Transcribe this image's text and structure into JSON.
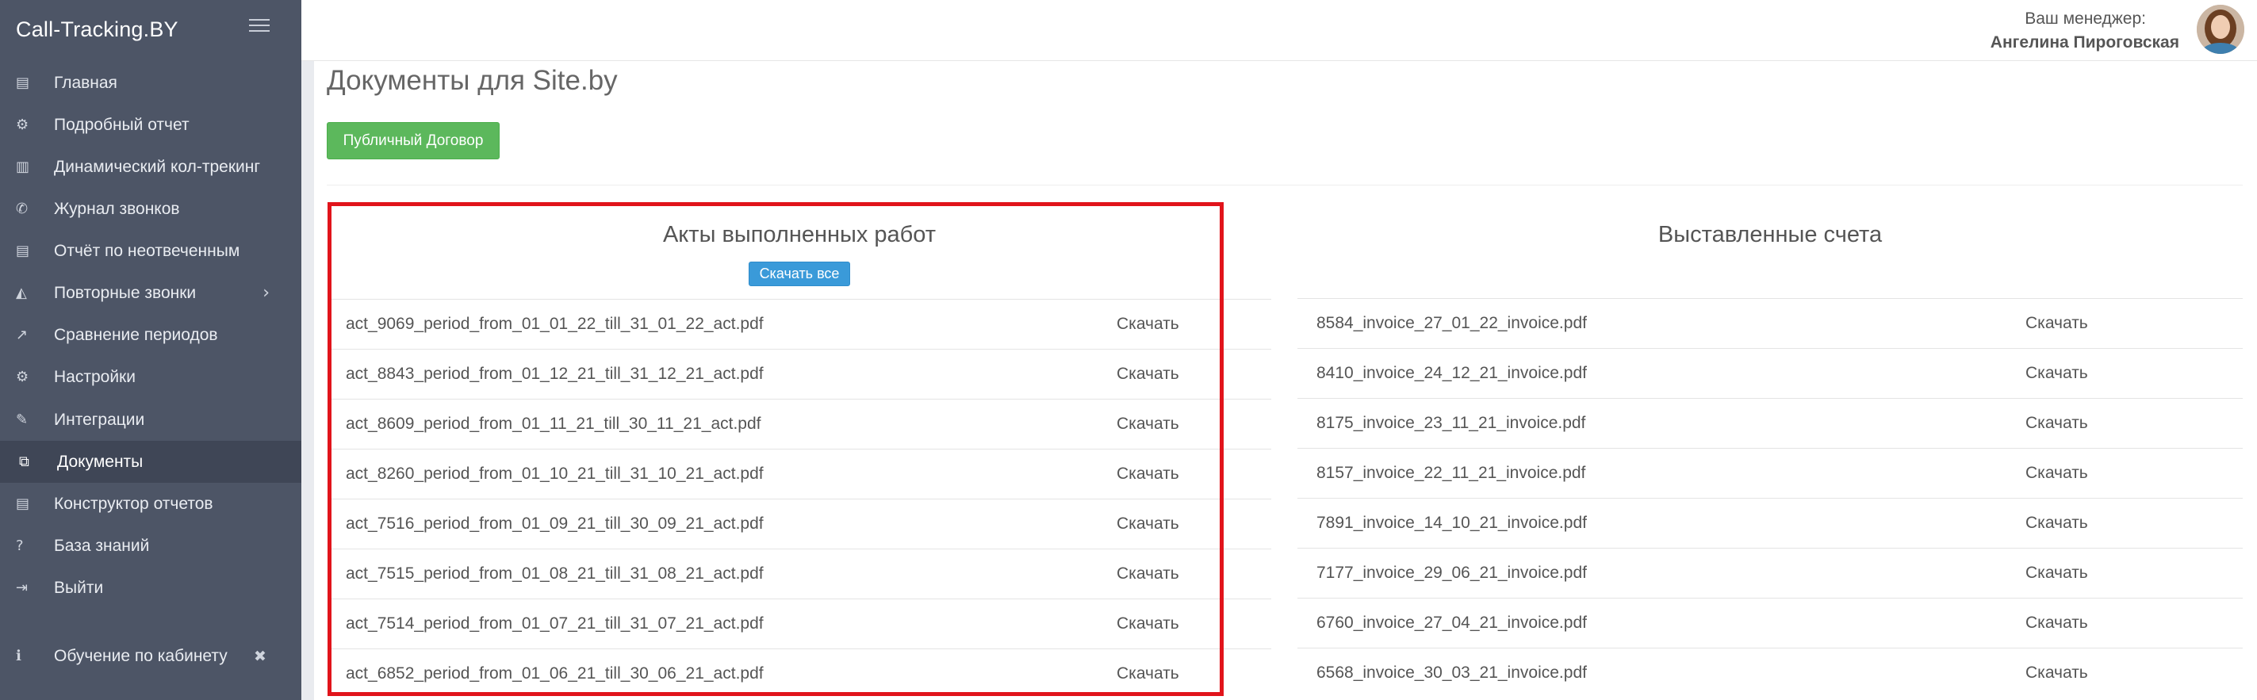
{
  "brand": "Call-Tracking.BY",
  "sidebar": {
    "items": [
      {
        "icon": "▤",
        "label": "Главная"
      },
      {
        "icon": "⚙",
        "label": "Подробный отчет"
      },
      {
        "icon": "▥",
        "label": "Динамический кол-трекинг"
      },
      {
        "icon": "✆",
        "label": "Журнал звонков"
      },
      {
        "icon": "▤",
        "label": "Отчёт по неотвеченным"
      },
      {
        "icon": "◭",
        "label": "Повторные звонки",
        "chevron": "›"
      },
      {
        "icon": "↗",
        "label": "Сравнение периодов"
      },
      {
        "icon": "⚙",
        "label": "Настройки"
      },
      {
        "icon": "✎",
        "label": "Интеграции"
      },
      {
        "icon": "⧉",
        "label": "Документы"
      },
      {
        "icon": "▤",
        "label": "Конструктор отчетов"
      },
      {
        "icon": "?",
        "label": "База знаний"
      },
      {
        "icon": "⇥",
        "label": "Выйти"
      }
    ],
    "training": {
      "icon": "ℹ",
      "label": "Обучение по кабинету",
      "close": "✖"
    }
  },
  "header": {
    "manager_label": "Ваш менеджер:",
    "manager_name": "Ангелина Пироговская"
  },
  "main": {
    "title": "Документы для Site.by",
    "public_contract_button": "Публичный Договор",
    "acts": {
      "title": "Акты выполненных работ",
      "download_all": "Скачать все",
      "download_label": "Скачать",
      "files": [
        "act_9069_period_from_01_01_22_till_31_01_22_act.pdf",
        "act_8843_period_from_01_12_21_till_31_12_21_act.pdf",
        "act_8609_period_from_01_11_21_till_30_11_21_act.pdf",
        "act_8260_period_from_01_10_21_till_31_10_21_act.pdf",
        "act_7516_period_from_01_09_21_till_30_09_21_act.pdf",
        "act_7515_period_from_01_08_21_till_31_08_21_act.pdf",
        "act_7514_period_from_01_07_21_till_31_07_21_act.pdf",
        "act_6852_period_from_01_06_21_till_30_06_21_act.pdf"
      ]
    },
    "invoices": {
      "title": "Выставленные счета",
      "download_label": "Скачать",
      "files": [
        "8584_invoice_27_01_22_invoice.pdf",
        "8410_invoice_24_12_21_invoice.pdf",
        "8175_invoice_23_11_21_invoice.pdf",
        "8157_invoice_22_11_21_invoice.pdf",
        "7891_invoice_14_10_21_invoice.pdf",
        "7177_invoice_29_06_21_invoice.pdf",
        "6760_invoice_27_04_21_invoice.pdf",
        "6568_invoice_30_03_21_invoice.pdf"
      ]
    }
  },
  "colors": {
    "sidebar_bg": "#4d5566",
    "sidebar_active": "#3f4656",
    "green_button": "#5cb85c",
    "blue_button": "#3a9ad9",
    "highlight_box": "#e1141b"
  }
}
